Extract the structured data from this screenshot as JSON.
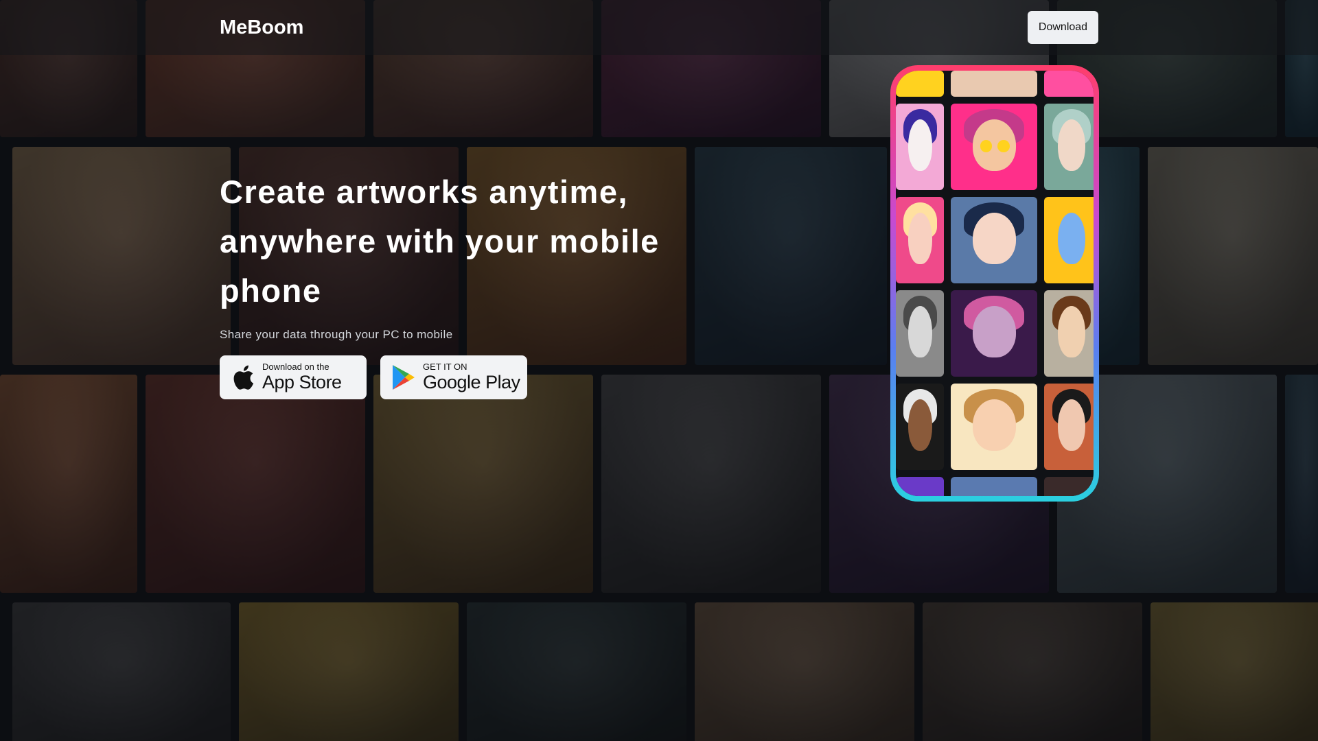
{
  "header": {
    "brand": "MeBoom",
    "download_label": "Download"
  },
  "hero": {
    "title": "Create artworks anytime, anywhere with your mobile phone",
    "subtitle": "Share your data through your PC to mobile"
  },
  "badges": {
    "appstore": {
      "small": "Download on the",
      "large": "App Store",
      "icon": "apple-icon"
    },
    "google": {
      "small": "GET IT ON",
      "large": "Google Play",
      "icon": "google-play-icon"
    }
  },
  "colors": {
    "accent_pink": "#ff3e6c",
    "accent_cyan": "#2bd0e0",
    "button_bg": "#eef0f3"
  }
}
